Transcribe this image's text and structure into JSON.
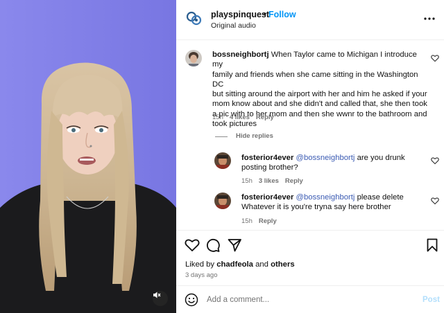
{
  "post": {
    "username": "playspinquest",
    "separator": "•",
    "follow_label": "Follow",
    "audio_label": "Original audio"
  },
  "icons": {
    "more": "more-options-icon",
    "like": "heart-icon",
    "comment": "comment-icon",
    "share": "share-icon",
    "save": "bookmark-icon",
    "emoji": "emoji-icon",
    "mute": "mute-icon"
  },
  "comments": [
    {
      "username": "bossneighbortj",
      "lines": [
        "When Taylor came to Michigan I introduce my",
        "family and friends when she came sitting in the Washington DC",
        "but sitting around the airport with her and him he asked if your",
        "mom know about and she didn't and called that, she then took",
        "a pic with to her mom and then she wwnr to the bathroom and",
        "took pictures"
      ],
      "time": "15h",
      "likes": "4 likes",
      "reply": "Reply"
    }
  ],
  "hide_replies_label": "Hide replies",
  "replies": [
    {
      "username": "fosterior4ever",
      "mention": "@bossneighbortj",
      "line1_rest": " are you drunk",
      "line2": "posting brother?",
      "time": "15h",
      "likes": "3 likes",
      "reply": "Reply"
    },
    {
      "username": "fosterior4ever",
      "mention": "@bossneighbortj",
      "line1_rest": " please delete",
      "line2": "Whatever it is you're tryna say here brother",
      "time": "15h",
      "reply": "Reply"
    }
  ],
  "likes_summary": {
    "prefix": "Liked by ",
    "user": "chadfeola",
    "middle": " and ",
    "others": "others"
  },
  "posted_ago": "3 days ago",
  "composer": {
    "placeholder": "Add a comment...",
    "post_label": "Post"
  },
  "colors": {
    "media_background": "#7f7ce8",
    "follow_blue": "#0095f6",
    "mention_blue": "#3b5bb3",
    "post_disabled": "#b2dffc"
  }
}
